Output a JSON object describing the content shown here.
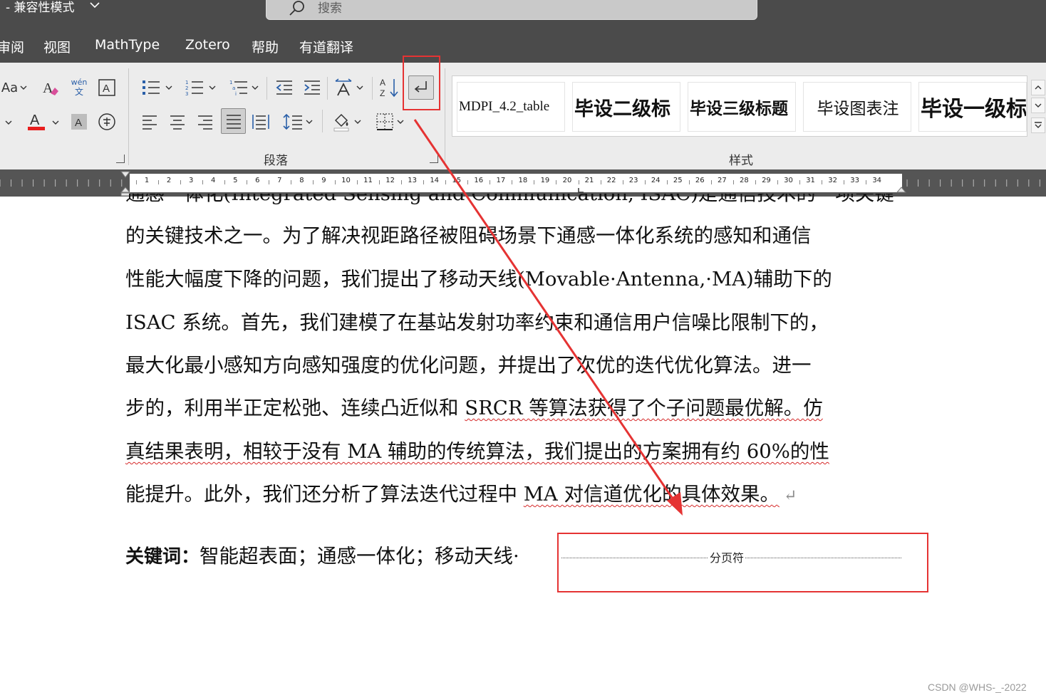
{
  "window": {
    "title": "- 兼容性模式"
  },
  "search": {
    "placeholder": "搜索"
  },
  "tabs": [
    "审阅",
    "视图",
    "MathType",
    "Zotero",
    "帮助",
    "有道翻译"
  ],
  "font_group": {
    "font_color": "#e81e1e",
    "phonetic_top": "wén",
    "phonetic_bottom": "文",
    "change_case": "Aa"
  },
  "groups": {
    "paragraph": "段落",
    "styles": "样式"
  },
  "styles_gallery": [
    "MDPI_4.2_table",
    "毕设二级标",
    "毕设三级标题",
    "毕设图表注",
    "毕设一级标"
  ],
  "ruler": {
    "numbers": [
      "1",
      "2",
      "3",
      "4",
      "5",
      "6",
      "7",
      "8",
      "9",
      "10",
      "11",
      "12",
      "13",
      "14",
      "15",
      "16",
      "17",
      "18",
      "19",
      "20",
      "21",
      "22",
      "23",
      "24",
      "25",
      "26",
      "27",
      "28",
      "29",
      "30",
      "31",
      "32",
      "33",
      "34"
    ]
  },
  "document": {
    "line0": "通感一体化(Integrated Sensing and Communication, ISAC)是通信技术的一项关键",
    "line1": "的关键技术之一。为了解决视距路径被阻碍场景下通感一体化系统的感知和通信",
    "line2": "性能大幅度下降的问题，我们提出了移动天线(Movable·Antenna,·MA)辅助下的",
    "line3": "ISAC 系统。首先，我们建模了在基站发射功率约束和通信用户信噪比限制下的，",
    "line4": "最大化最小感知方向感知强度的优化问题，并提出了次优的迭代优化算法。进一",
    "line5_a": "步的，利用半正定松弛、连续凸近似和 ",
    "line5_b": "SRCR 等算法获得了个子问题最优解。仿",
    "line6": "真结果表明，相较于没有 MA 辅助的传统算法，我们提出的方案拥有约 60%的性",
    "line7_a": "能提升。此外，我们还分析了算法迭代过程中 ",
    "line7_b": "MA 对信道优化的具体效果。",
    "para_mark": "↵",
    "keywords_label": "关键词：",
    "keywords": "智能超表面；通感一体化；移动天线·",
    "page_break_label": "分页符"
  },
  "annotation": {
    "color": "#e53333"
  },
  "watermark": "CSDN @WHS-_-2022"
}
